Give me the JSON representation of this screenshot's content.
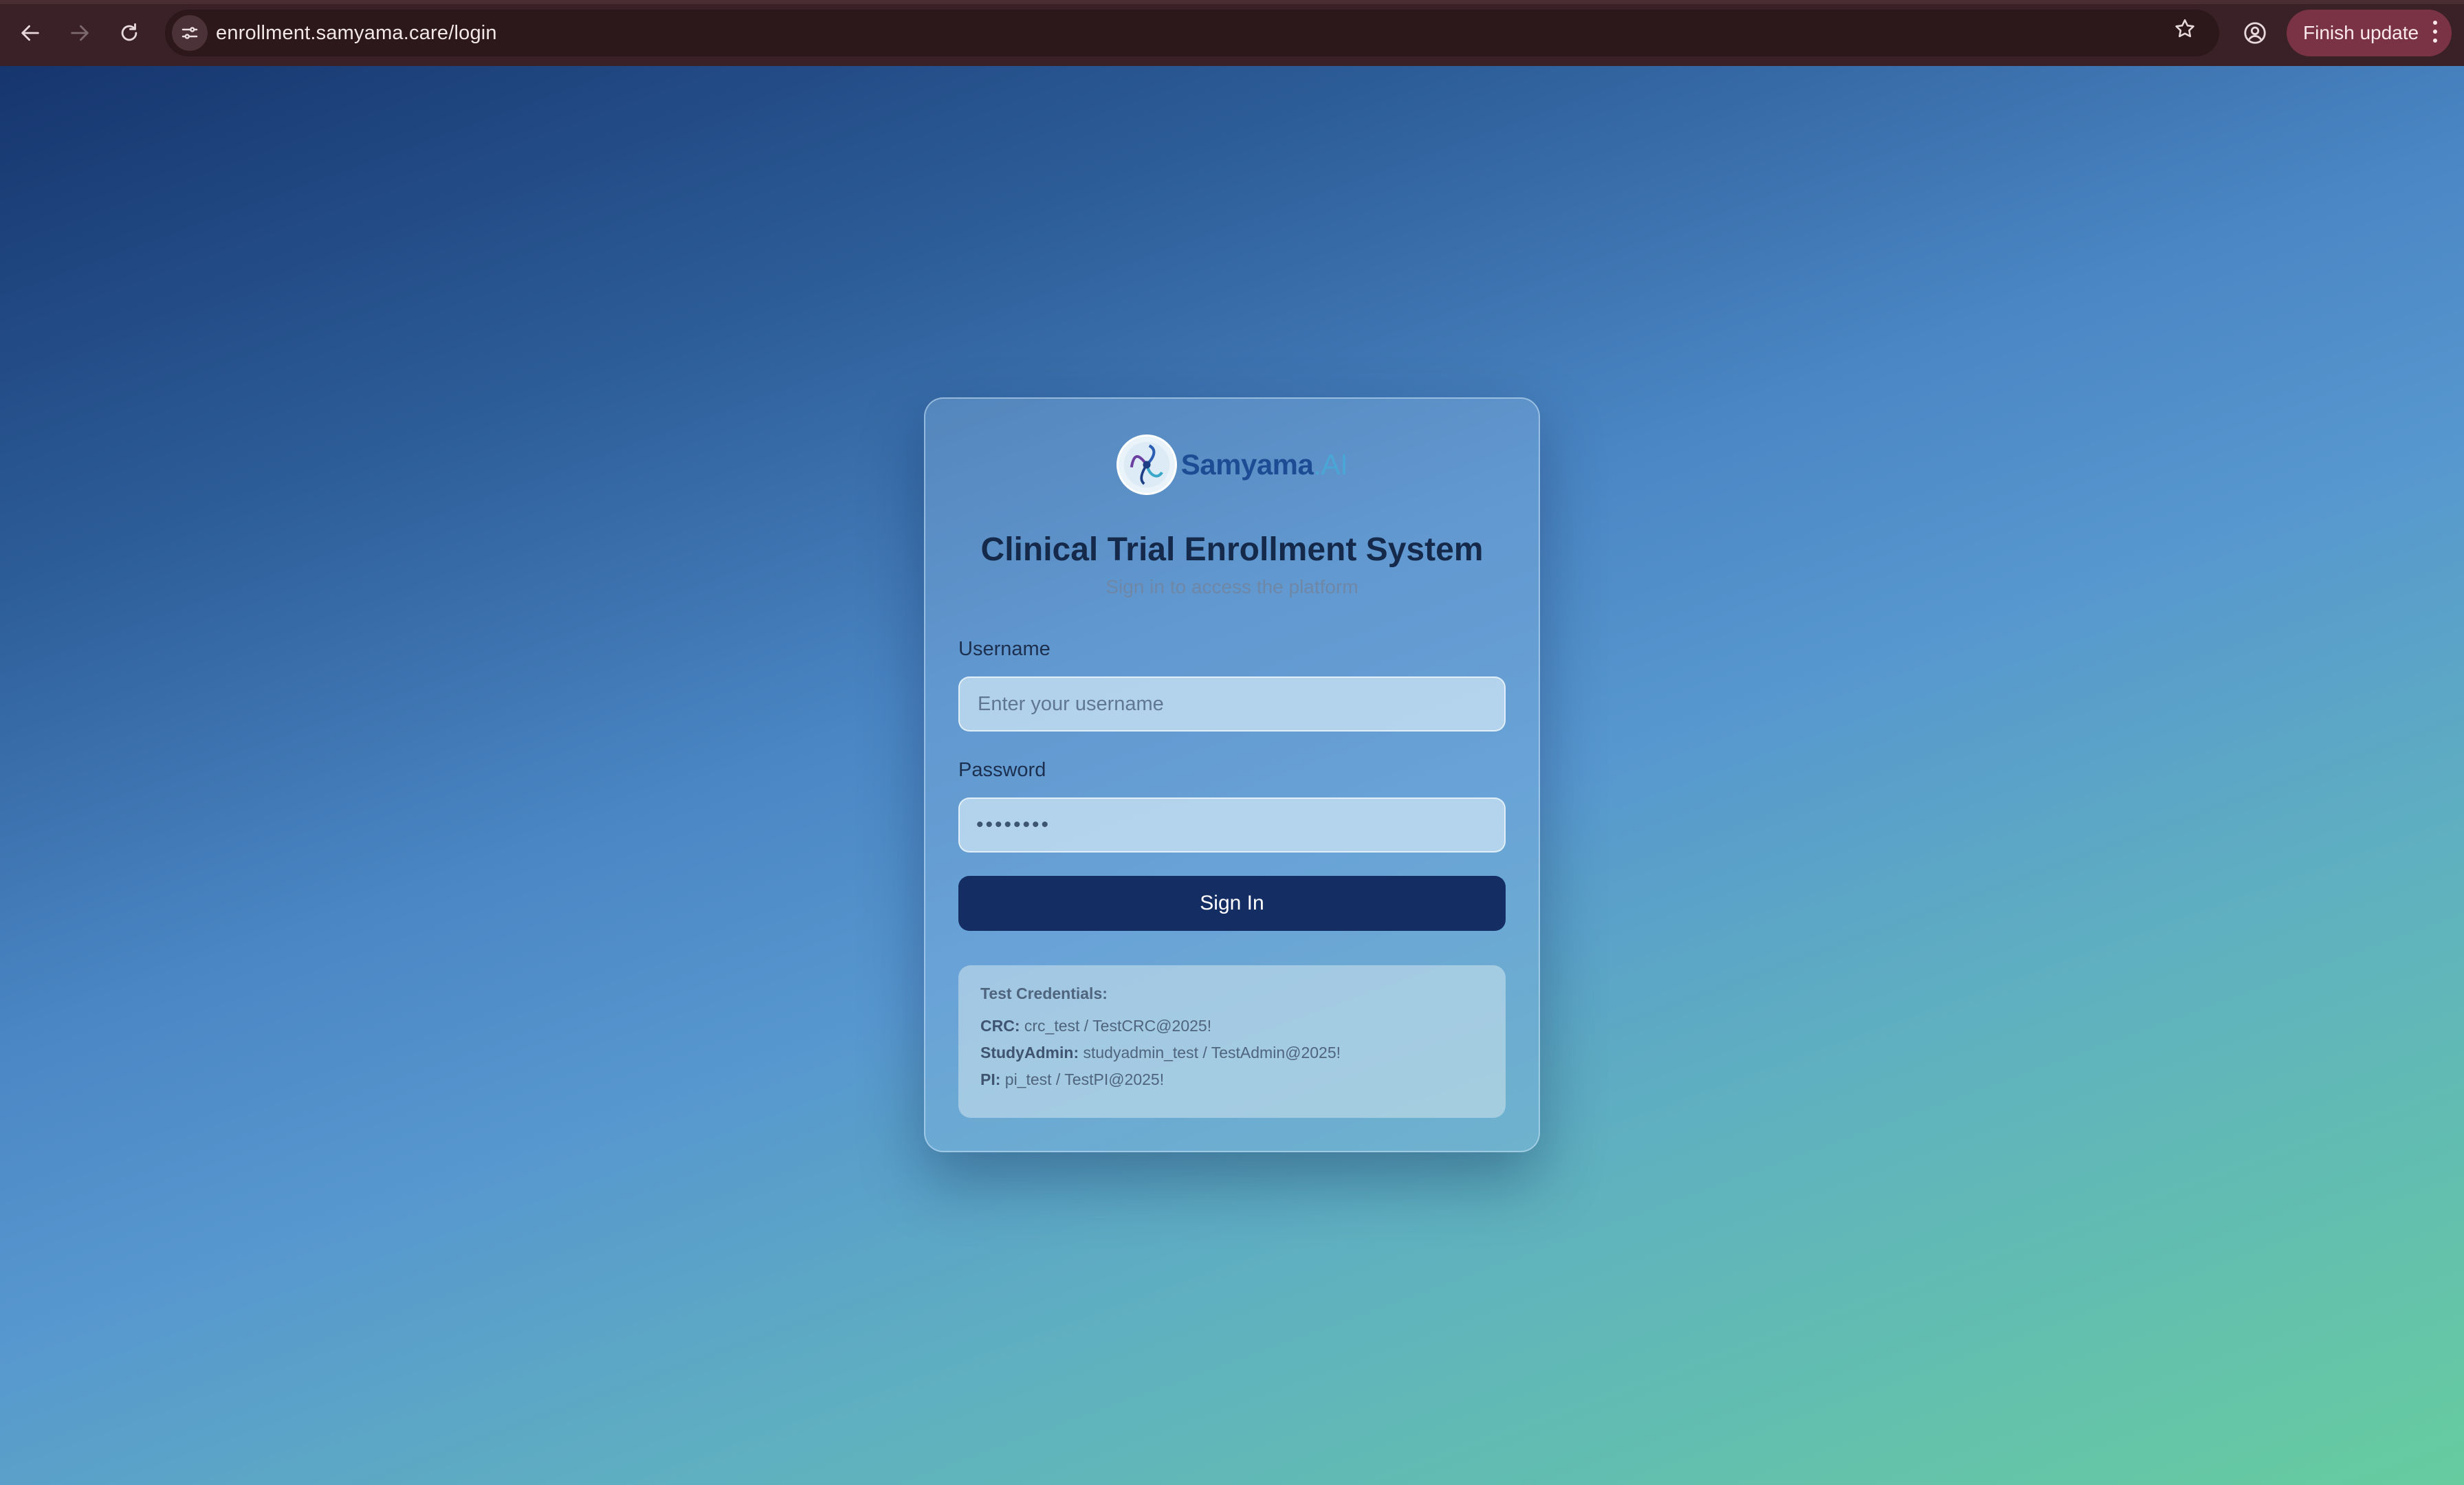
{
  "browser": {
    "url": "enrollment.samyama.care/login",
    "update_button": "Finish update"
  },
  "brand": {
    "name": "Samyama",
    "suffix": ".AI"
  },
  "login": {
    "title": "Clinical Trial Enrollment System",
    "subtitle": "Sign in to access the platform",
    "username_label": "Username",
    "username_placeholder": "Enter your username",
    "password_label": "Password",
    "password_value": "••••••••",
    "signin_label": "Sign In"
  },
  "credentials": {
    "heading": "Test Credentials:",
    "rows": [
      {
        "role": "CRC:",
        "value": "crc_test / TestCRC@2025!"
      },
      {
        "role": "StudyAdmin:",
        "value": "studyadmin_test / TestAdmin@2025!"
      },
      {
        "role": "PI:",
        "value": "pi_test / TestPI@2025!"
      }
    ]
  },
  "colors": {
    "primary_button": "#142d63",
    "title": "#15294a",
    "brand_blue": "#1e4c94"
  }
}
